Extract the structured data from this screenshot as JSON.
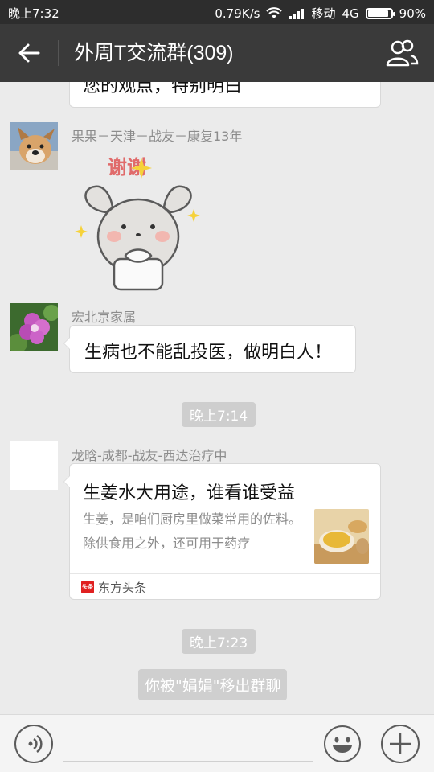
{
  "status_bar": {
    "time": "晚上7:32",
    "network_speed": "0.79K/s",
    "carrier": "移动",
    "network_type": "4G",
    "battery": "90%",
    "battery_level": 0.9
  },
  "header": {
    "title": "外周T交流群(309)"
  },
  "chat": {
    "previous_message": "您的观点，特别明白",
    "messages": [
      {
        "sender": "果果－天津－战友－康复13年",
        "sticker_text": "谢谢"
      },
      {
        "sender": "宏北京家属",
        "text": "生病也不能乱投医，做明白人！"
      }
    ],
    "timestamp_1": "晚上7:14",
    "article": {
      "sender": "龙晗-成都-战友-西达治疗中",
      "title": "生姜水大用途，谁看谁受益",
      "description": "生姜，是咱们厨房里做菜常用的佐料。除供食用之外，还可用于药疗",
      "source": "东方头条",
      "source_icon_text": "头条"
    },
    "timestamp_2": "晚上7:23",
    "system_notice": "你被\"娟娟\"移出群聊"
  },
  "colors": {
    "header_bg": "#3a3a3a",
    "status_bg": "#2d2d2d",
    "chat_bg": "#ebebeb",
    "source_red": "#e02020"
  }
}
